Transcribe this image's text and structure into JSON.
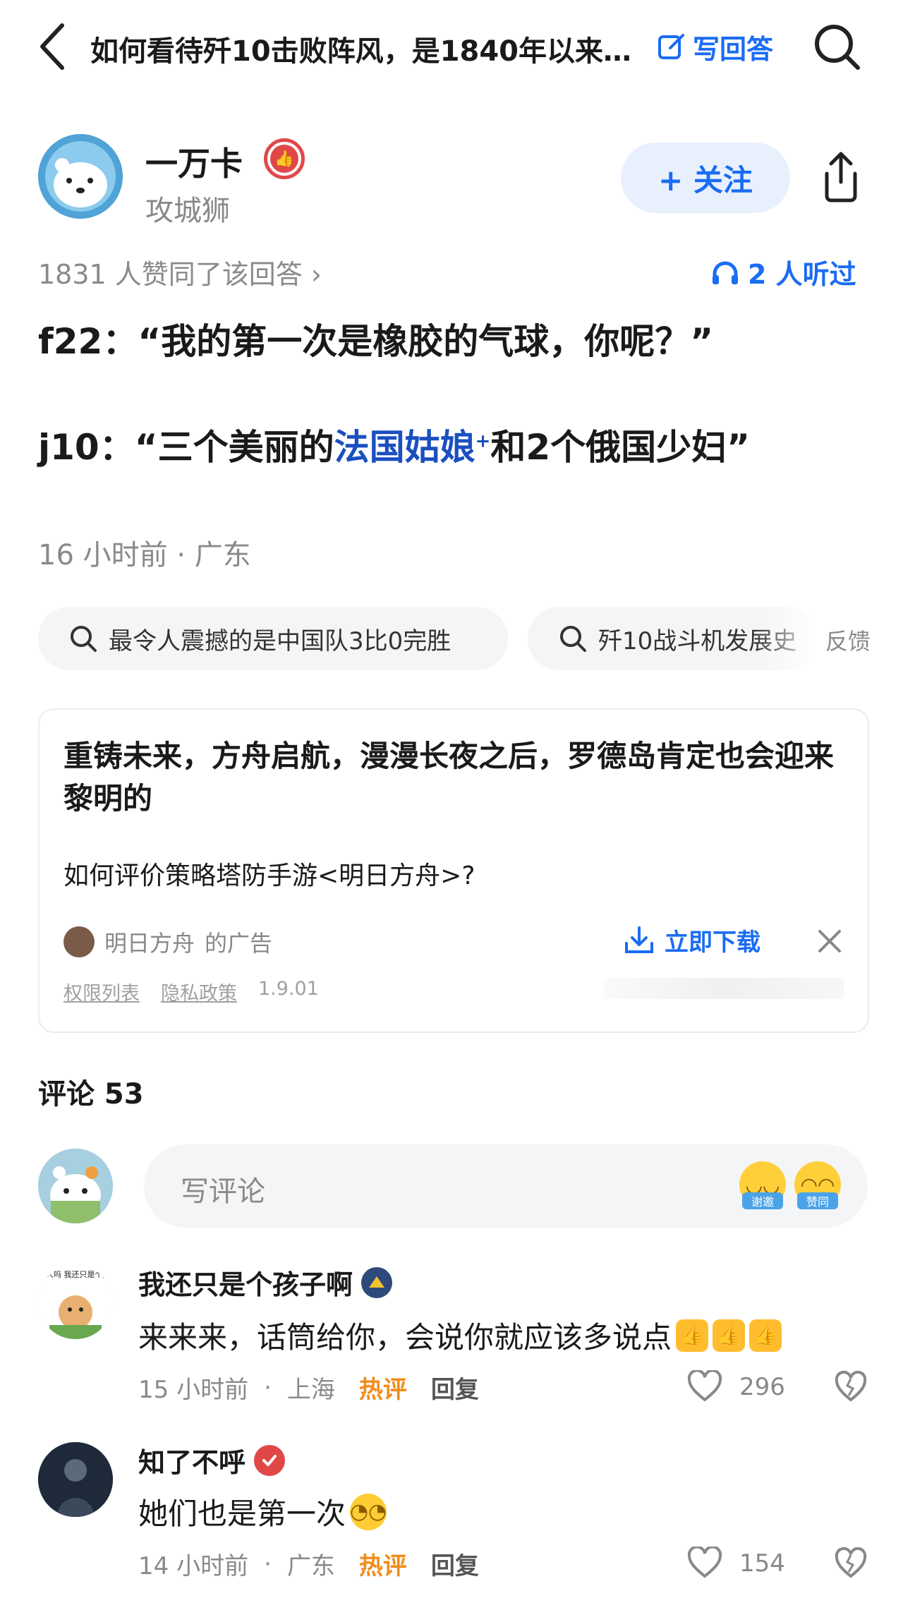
{
  "topbar": {
    "title": "如何看待歼10击败阵风，是1840年以来…",
    "write_answer": "写回答",
    "back_icon": "back-icon",
    "search_icon": "search-icon"
  },
  "author": {
    "name": "一万卡",
    "title": "攻城狮",
    "follow": "+ 关注",
    "badge_icon": "thumbs-up-badge-icon"
  },
  "stats": {
    "agree": "1831 人赞同了该回答 ›",
    "listen": "2 人听过"
  },
  "answer": {
    "line1": "f22：“我的第一次是橡胶的气球，你呢？”",
    "line2_pre": "j10：“三个美丽的",
    "line2_link": "法国姑娘",
    "line2_sup": "+",
    "line2_post": "和2个俄国少妇”",
    "meta": "16 小时前 · 广东"
  },
  "search_chips": [
    {
      "label": "最令人震撼的是中国队3比0完胜"
    },
    {
      "label": "歼10战斗机发展史"
    }
  ],
  "feedback": "反馈",
  "ad": {
    "headline": "重铸未来，方舟启航，漫漫长夜之后，罗德岛肯定也会迎来黎明的",
    "subtitle": "如何评价策略塔防手游<明日方舟>?",
    "source": "明日方舟",
    "source_suffix": "的广告",
    "download": "立即下载",
    "permissions": "权限列表",
    "privacy": "隐私政策",
    "version": "1.9.01"
  },
  "comments": {
    "title": "评论 53",
    "input_placeholder": "写评论",
    "quick_emoji_1": "谢邀",
    "quick_emoji_2": "赞同",
    "items": [
      {
        "name": "我还只是个孩子啊",
        "text": "来来来，话筒给你，会说你就应该多说点",
        "time": "15 小时前",
        "location": "上海",
        "hot": "热评",
        "reply": "回复",
        "likes": "296",
        "avatar_caption": "你还是人吗 我还只是个孩子 啊"
      },
      {
        "name": "知了不呼",
        "text": "她们也是第一次",
        "time": "14 小时前",
        "location": "广东",
        "hot": "热评",
        "reply": "回复",
        "likes": "154"
      }
    ]
  },
  "colors": {
    "accent": "#1a6cf2",
    "hot": "#f28c1a",
    "muted": "#8a8a8a",
    "badge_red": "#e04848"
  }
}
